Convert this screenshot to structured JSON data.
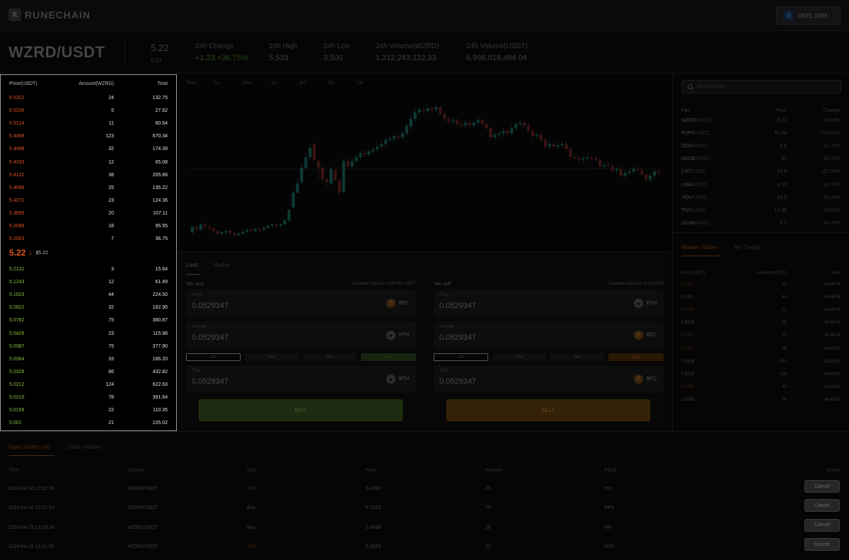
{
  "header": {
    "logo_glyph": "R",
    "brand": "RUNECHAIN",
    "wallet_address": "0X23..1343"
  },
  "ticker": {
    "pair": "WZRD/USDT",
    "last_price": "5.22",
    "last_price_sub": "5.22",
    "change_label": "24h Change",
    "change_value": "+1.23 +36.75%",
    "high_label": "24h High",
    "high_value": "5.533",
    "low_label": "24h Low",
    "low_value": "3.500",
    "vol_wzrd_label": "24h Volume(WZRD)",
    "vol_wzrd_value": "1,212,243,122.33",
    "vol_usdt_label": "24h Volume(USDT)",
    "vol_usdt_value": "6,996,519,484.04"
  },
  "orderbook": {
    "col_price": "Price(USDT)",
    "col_amount": "Amount(WZRD)",
    "col_total": "Total",
    "asks": [
      {
        "price": "5.5312",
        "amount": "24",
        "total": "132.75"
      },
      {
        "price": "5.5235",
        "amount": "5",
        "total": "27.62"
      },
      {
        "price": "5.5124",
        "amount": "11",
        "total": "60.64"
      },
      {
        "price": "5.4499",
        "amount": "123",
        "total": "670.34"
      },
      {
        "price": "5.4498",
        "amount": "32",
        "total": "174.39"
      },
      {
        "price": "5.4233",
        "amount": "12",
        "total": "65.08"
      },
      {
        "price": "5.4122",
        "amount": "38",
        "total": "205.66"
      },
      {
        "price": "5.4088",
        "amount": "25",
        "total": "135.22"
      },
      {
        "price": "5.4071",
        "amount": "23",
        "total": "124.36"
      },
      {
        "price": "5.3555",
        "amount": "20",
        "total": "107.11"
      },
      {
        "price": "5.3086",
        "amount": "18",
        "total": "95.55"
      },
      {
        "price": "5.2503",
        "amount": "7",
        "total": "36.75"
      }
    ],
    "mid_price": "5.22",
    "mid_arrow": "↓",
    "mid_ref": "$5.22",
    "bids": [
      {
        "price": "5.2122",
        "amount": "3",
        "total": "15.64"
      },
      {
        "price": "5.1243",
        "amount": "12",
        "total": "61.49"
      },
      {
        "price": "5.1023",
        "amount": "44",
        "total": "224.50"
      },
      {
        "price": "5.0922",
        "amount": "32",
        "total": "162.95"
      },
      {
        "price": "5.0782",
        "amount": "75",
        "total": "380.87"
      },
      {
        "price": "5.0426",
        "amount": "23",
        "total": "115.98"
      },
      {
        "price": "5.0387",
        "amount": "75",
        "total": "377.90"
      },
      {
        "price": "5.0364",
        "amount": "33",
        "total": "166.20"
      },
      {
        "price": "5.0328",
        "amount": "86",
        "total": "432.82"
      },
      {
        "price": "5.0212",
        "amount": "124",
        "total": "622.63"
      },
      {
        "price": "5.0210",
        "amount": "78",
        "total": "391.64"
      },
      {
        "price": "5.0159",
        "amount": "22",
        "total": "110.35"
      },
      {
        "price": "5.001",
        "amount": "21",
        "total": "105.02"
      }
    ]
  },
  "chart": {
    "timeframes": [
      "Time",
      "1s",
      "15m",
      "1H",
      "4H",
      "1D",
      "1W"
    ],
    "colors": {
      "up": "#0f3a34",
      "down": "#3a1414",
      "wick": "#1f1f1f",
      "ref_line": "#2a2a2a"
    }
  },
  "chart_data": {
    "type": "candlestick",
    "candles": [
      [
        3.62,
        3.7,
        3.6,
        3.72
      ],
      [
        3.7,
        3.66,
        3.64,
        3.73
      ],
      [
        3.66,
        3.74,
        3.64,
        3.76
      ],
      [
        3.74,
        3.7,
        3.66,
        3.76
      ],
      [
        3.7,
        3.68,
        3.64,
        3.74
      ],
      [
        3.68,
        3.64,
        3.6,
        3.7
      ],
      [
        3.64,
        3.6,
        3.56,
        3.66
      ],
      [
        3.6,
        3.62,
        3.56,
        3.65
      ],
      [
        3.62,
        3.64,
        3.58,
        3.66
      ],
      [
        3.64,
        3.61,
        3.57,
        3.66
      ],
      [
        3.61,
        3.58,
        3.54,
        3.63
      ],
      [
        3.58,
        3.6,
        3.55,
        3.63
      ],
      [
        3.6,
        3.63,
        3.57,
        3.65
      ],
      [
        3.63,
        3.66,
        3.61,
        3.68
      ],
      [
        3.66,
        3.64,
        3.61,
        3.69
      ],
      [
        3.64,
        3.67,
        3.62,
        3.69
      ],
      [
        3.67,
        3.66,
        3.63,
        3.7
      ],
      [
        3.66,
        3.69,
        3.64,
        3.71
      ],
      [
        3.69,
        3.72,
        3.67,
        3.74
      ],
      [
        3.72,
        3.74,
        3.7,
        3.76
      ],
      [
        3.74,
        3.72,
        3.7,
        3.76
      ],
      [
        3.72,
        3.74,
        3.7,
        3.76
      ],
      [
        3.74,
        3.8,
        3.72,
        3.82
      ],
      [
        3.8,
        3.96,
        3.78,
        3.98
      ],
      [
        4.0,
        4.22,
        3.98,
        4.26
      ],
      [
        4.22,
        4.36,
        4.2,
        4.42
      ],
      [
        4.38,
        4.6,
        4.34,
        4.66
      ],
      [
        4.6,
        4.76,
        4.56,
        4.82
      ],
      [
        4.76,
        4.9,
        4.72,
        4.96
      ],
      [
        4.96,
        4.72,
        4.68,
        4.99
      ],
      [
        4.7,
        4.6,
        4.4,
        4.74
      ],
      [
        4.6,
        4.42,
        4.36,
        4.64
      ],
      [
        4.42,
        4.38,
        4.3,
        4.46
      ],
      [
        4.36,
        4.58,
        4.32,
        4.62
      ],
      [
        4.56,
        4.42,
        4.38,
        4.6
      ],
      [
        4.4,
        4.22,
        4.16,
        4.44
      ],
      [
        4.24,
        4.7,
        4.2,
        4.74
      ],
      [
        4.7,
        4.62,
        4.58,
        4.76
      ],
      [
        4.62,
        4.7,
        4.58,
        4.74
      ],
      [
        4.7,
        4.76,
        4.66,
        4.8
      ],
      [
        4.76,
        4.82,
        4.72,
        4.86
      ],
      [
        4.82,
        4.8,
        4.76,
        4.86
      ],
      [
        4.8,
        4.85,
        4.76,
        4.88
      ],
      [
        4.85,
        4.88,
        4.82,
        4.92
      ],
      [
        4.88,
        4.92,
        4.84,
        4.96
      ],
      [
        4.92,
        4.96,
        4.88,
        5.0
      ],
      [
        4.96,
        5.02,
        4.92,
        5.06
      ],
      [
        5.02,
        5.04,
        4.98,
        5.08
      ],
      [
        5.04,
        5.08,
        5.0,
        5.12
      ],
      [
        5.08,
        5.06,
        5.02,
        5.12
      ],
      [
        5.06,
        5.12,
        5.02,
        5.16
      ],
      [
        5.12,
        5.24,
        5.08,
        5.28
      ],
      [
        5.22,
        5.34,
        5.18,
        5.38
      ],
      [
        5.34,
        5.44,
        5.3,
        5.48
      ],
      [
        5.44,
        5.48,
        5.4,
        5.52
      ],
      [
        5.48,
        5.46,
        5.42,
        5.52
      ],
      [
        5.46,
        5.5,
        5.42,
        5.54
      ],
      [
        5.5,
        5.48,
        5.44,
        5.54
      ],
      [
        5.48,
        5.52,
        5.44,
        5.55
      ],
      [
        5.52,
        5.42,
        5.38,
        5.54
      ],
      [
        5.42,
        5.34,
        5.3,
        5.46
      ],
      [
        5.34,
        5.3,
        5.26,
        5.38
      ],
      [
        5.3,
        5.32,
        5.26,
        5.36
      ],
      [
        5.32,
        5.26,
        5.22,
        5.36
      ],
      [
        5.26,
        5.24,
        5.2,
        5.3
      ],
      [
        5.24,
        5.28,
        5.2,
        5.32
      ],
      [
        5.28,
        5.24,
        5.2,
        5.32
      ],
      [
        5.24,
        5.28,
        5.2,
        5.32
      ],
      [
        5.28,
        5.32,
        5.24,
        5.36
      ],
      [
        5.32,
        5.26,
        5.22,
        5.36
      ],
      [
        5.26,
        5.2,
        5.16,
        5.3
      ],
      [
        5.2,
        5.06,
        5.02,
        5.24
      ],
      [
        5.06,
        5.1,
        5.02,
        5.14
      ],
      [
        5.1,
        5.12,
        5.06,
        5.16
      ],
      [
        5.12,
        5.16,
        5.08,
        5.2
      ],
      [
        5.16,
        5.12,
        5.08,
        5.2
      ],
      [
        5.12,
        5.2,
        5.08,
        5.24
      ],
      [
        5.2,
        5.26,
        5.16,
        5.3
      ],
      [
        5.26,
        5.28,
        5.22,
        5.32
      ],
      [
        5.28,
        5.24,
        5.2,
        5.32
      ],
      [
        5.24,
        5.16,
        5.12,
        5.28
      ],
      [
        5.16,
        5.08,
        5.04,
        5.2
      ],
      [
        5.08,
        5.1,
        5.04,
        5.14
      ],
      [
        5.1,
        5.02,
        4.98,
        5.14
      ],
      [
        5.02,
        4.92,
        4.88,
        5.06
      ],
      [
        4.92,
        4.96,
        4.88,
        5.0
      ],
      [
        4.96,
        4.92,
        4.88,
        5.0
      ],
      [
        4.92,
        4.94,
        4.88,
        4.98
      ],
      [
        4.94,
        4.96,
        4.9,
        5.0
      ],
      [
        4.96,
        4.88,
        4.84,
        5.0
      ],
      [
        4.88,
        4.76,
        4.72,
        4.92
      ],
      [
        4.76,
        4.74,
        4.7,
        4.8
      ],
      [
        4.74,
        4.72,
        4.68,
        4.78
      ],
      [
        4.72,
        4.74,
        4.68,
        4.78
      ],
      [
        4.74,
        4.76,
        4.7,
        4.8
      ],
      [
        4.76,
        4.74,
        4.7,
        4.8
      ],
      [
        4.74,
        4.72,
        4.68,
        4.78
      ],
      [
        4.72,
        4.62,
        4.58,
        4.76
      ],
      [
        4.62,
        4.64,
        4.58,
        4.68
      ],
      [
        4.64,
        4.62,
        4.58,
        4.68
      ],
      [
        4.62,
        4.56,
        4.52,
        4.66
      ],
      [
        4.56,
        4.58,
        4.52,
        4.62
      ],
      [
        4.58,
        4.48,
        4.44,
        4.62
      ],
      [
        4.48,
        4.52,
        4.44,
        4.56
      ],
      [
        4.52,
        4.54,
        4.48,
        4.58
      ],
      [
        4.54,
        4.58,
        4.5,
        4.62
      ],
      [
        4.58,
        4.56,
        4.52,
        4.62
      ],
      [
        4.56,
        4.5,
        4.46,
        4.6
      ],
      [
        4.5,
        4.42,
        4.38,
        4.54
      ],
      [
        4.42,
        4.48,
        4.38,
        4.52
      ],
      [
        4.48,
        4.54,
        4.44,
        4.58
      ],
      [
        4.54,
        4.52,
        4.48,
        4.58
      ]
    ],
    "reference_price": 4.58,
    "ylim": [
      3.45,
      5.65
    ]
  },
  "trade": {
    "tab_limit": "Limit",
    "tab_market": "Market",
    "buy": {
      "side_label": "You buy",
      "balance": "Available balance 4,984.84 USDT",
      "price_label": "Price",
      "price_value": "0.0529347",
      "price_cur": "BTC",
      "price_glyph": "₿",
      "amount_label": "Amount",
      "amount_value": "0.0529347",
      "amount_cur": "ETH",
      "amount_glyph": "◆",
      "pcts": [
        "10%",
        "25%",
        "50%",
        "MAX"
      ],
      "total_label": "Total",
      "total_value": "0.0529347",
      "total_cur": "ETH",
      "total_glyph": "◆",
      "button": "BUY"
    },
    "sell": {
      "side_label": "You sell",
      "balance": "Available balance 244 WZRD",
      "price_label": "Price",
      "price_value": "0.0529347",
      "price_cur": "ETH",
      "price_glyph": "◆",
      "amount_label": "Amount",
      "amount_value": "0.0529347",
      "amount_cur": "BTC",
      "amount_glyph": "₿",
      "pcts": [
        "10%",
        "25%",
        "50%",
        "MAX"
      ],
      "total_label": "Total",
      "total_value": "0.0529347",
      "total_cur": "BTC",
      "total_glyph": "₿",
      "button": "SELL"
    }
  },
  "markets": {
    "search_placeholder": "Search coins",
    "col_pair": "Pair",
    "col_price": "Price",
    "col_change": "Change",
    "rows": [
      {
        "base": "WZRD",
        "quote": "/USDC",
        "price": "5.22",
        "change": "23.88%"
      },
      {
        "base": "PUPS",
        "quote": "/USDC",
        "price": "50.24",
        "change": "226.02%"
      },
      {
        "base": "DOG",
        "quote": "/USDC",
        "price": "6.9",
        "change": "81.76%"
      },
      {
        "base": "NODE",
        "quote": "/USDC",
        "price": "43",
        "change": "33.19%"
      },
      {
        "base": "CAT",
        "quote": "/USDC",
        "price": "15.4",
        "change": "157.24%"
      },
      {
        "base": "LINA",
        "quote": "/USDC",
        "price": "4.65",
        "change": "54.79%"
      },
      {
        "base": "YOU",
        "quote": "/USDC",
        "price": "81.3",
        "change": "95.49%"
      },
      {
        "base": "TIVI",
        "quote": "/USDC",
        "price": "17.46",
        "change": "74.65%"
      },
      {
        "base": "GUAR",
        "quote": "/USDC",
        "price": "6.5",
        "change": "34.78%"
      }
    ],
    "tab_market_trades": "Market Trades",
    "tab_my_trades": "My Trades",
    "trades_col_price": "Price(USDT)",
    "trades_col_amount": "Amount(WZRD)",
    "trades_col_time": "Time",
    "trades": [
      {
        "price": "5.5312",
        "amount": "12",
        "time": "14:46:58",
        "side": "sell"
      },
      {
        "price": "5.530",
        "amount": "44",
        "time": "14:46:54",
        "side": "buy"
      },
      {
        "price": "5.5126",
        "amount": "21",
        "time": "14:46:54",
        "side": "sell"
      },
      {
        "price": "5.5509",
        "amount": "55",
        "time": "14:46:54",
        "side": "buy"
      },
      {
        "price": "5.5512",
        "amount": "75",
        "time": "14:46:54",
        "side": "sell"
      },
      {
        "price": "5.5512",
        "amount": "95",
        "time": "14:46:50",
        "side": "sell"
      },
      {
        "price": "5.5508",
        "amount": "233",
        "time": "14:46:50",
        "side": "buy"
      },
      {
        "price": "5.5505",
        "amount": "135",
        "time": "14:46:50",
        "side": "buy"
      },
      {
        "price": "5.5508",
        "amount": "43",
        "time": "14:46:50",
        "side": "sell"
      },
      {
        "price": "5.5505",
        "amount": "74",
        "time": "14:46:50",
        "side": "buy"
      }
    ]
  },
  "orders": {
    "tab_open": "Open Orders (4)",
    "tab_history": "Order History",
    "headers": {
      "time": "Time",
      "symbol": "Symbol",
      "side": "Side",
      "price": "Price",
      "amount": "Amount",
      "filled": "Filled",
      "action": "Action"
    },
    "rows": [
      {
        "time": "2024-04-16 10:52:56",
        "symbol": "WZRD/USDT",
        "side": "Sell",
        "price": "5.4088",
        "amount": "25",
        "filled": "0%",
        "action": "Cancel"
      },
      {
        "time": "2024-04-16 10:51:53",
        "symbol": "WZRD/USDT",
        "side": "Buy",
        "price": "5.1023",
        "amount": "75",
        "filled": "34%",
        "action": "Cancel"
      },
      {
        "time": "2024-04-15 13:23:24",
        "symbol": "WZRD/USDT",
        "side": "Buy",
        "price": "5.4088",
        "amount": "25",
        "filled": "0%",
        "action": "Cancel"
      },
      {
        "time": "2024-04-15 13:11:28",
        "symbol": "WZRD/USDT",
        "side": "Sell",
        "price": "5.2503 ·",
        "amount": "12",
        "filled": "10%",
        "action": "Cancel"
      }
    ]
  }
}
